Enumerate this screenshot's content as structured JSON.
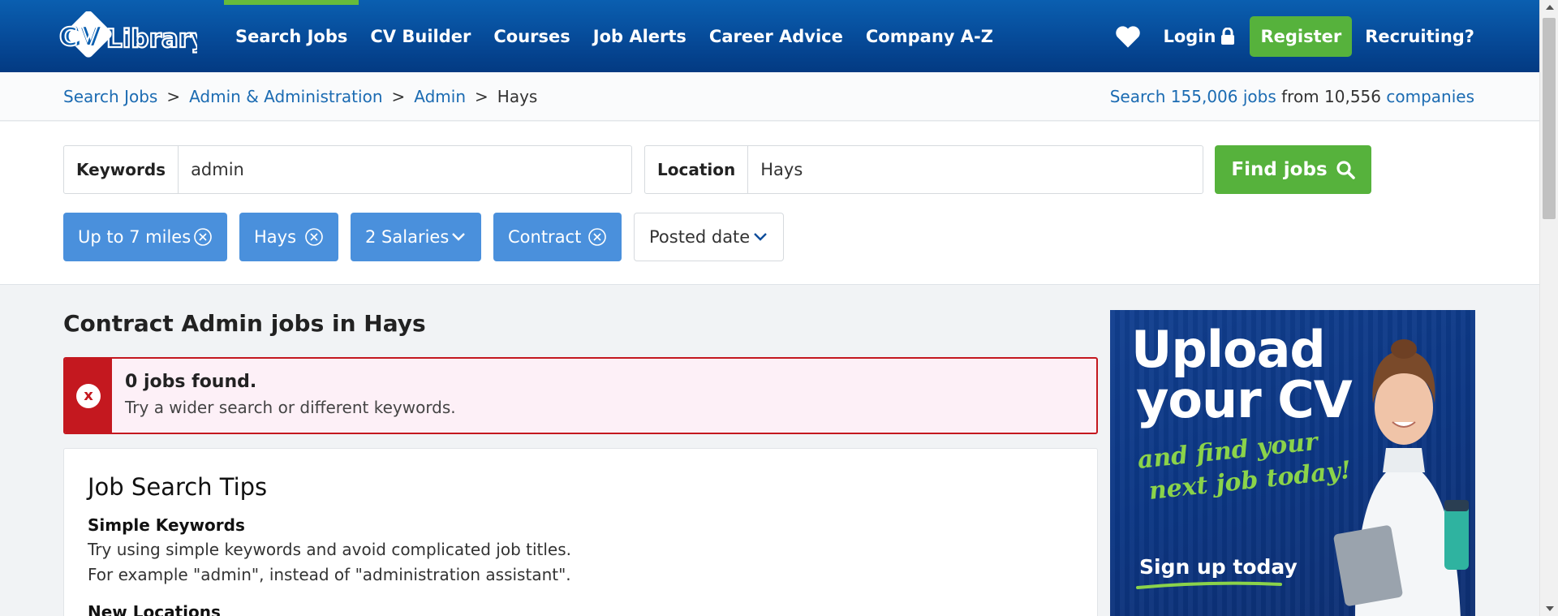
{
  "header": {
    "logo_text": "CV Library",
    "nav": [
      {
        "label": "Search Jobs",
        "active": true
      },
      {
        "label": "CV Builder"
      },
      {
        "label": "Courses"
      },
      {
        "label": "Job Alerts"
      },
      {
        "label": "Career Advice"
      },
      {
        "label": "Company A-Z"
      }
    ],
    "login_label": "Login",
    "register_label": "Register",
    "recruiting_label": "Recruiting?"
  },
  "breadcrumb": {
    "items": [
      "Search Jobs",
      "Admin & Administration",
      "Admin",
      "Hays"
    ],
    "separator": ">"
  },
  "stats": {
    "prefix": "Search",
    "jobs_link": "155,006 jobs",
    "middle": "from 10,556",
    "companies_link": "companies"
  },
  "search": {
    "keywords_label": "Keywords",
    "keywords_value": "admin",
    "location_label": "Location",
    "location_value": "Hays",
    "find_label": "Find jobs"
  },
  "filters": [
    {
      "label": "Up to 7 miles",
      "type": "removable"
    },
    {
      "label": "Hays",
      "type": "removable"
    },
    {
      "label": "2 Salaries",
      "type": "dropdown"
    },
    {
      "label": "Contract",
      "type": "removable"
    },
    {
      "label": "Posted date",
      "type": "dropdown"
    }
  ],
  "results": {
    "title": "Contract Admin jobs in Hays",
    "alert_title": "0 jobs found.",
    "alert_text": "Try a wider search or different keywords.",
    "alert_icon_text": "x"
  },
  "tips": {
    "title": "Job Search Tips",
    "sections": [
      {
        "heading": "Simple Keywords",
        "lines": [
          "Try using simple keywords and avoid complicated job titles.",
          "For example \"admin\", instead of \"administration assistant\"."
        ]
      },
      {
        "heading": "New Locations"
      }
    ]
  },
  "ad": {
    "line1": "Upload",
    "line2": "your CV",
    "line3": "and find your",
    "line4": "next job today!",
    "cta": "Sign up today"
  },
  "colors": {
    "header_blue": "#064a98",
    "accent_green": "#56b23c",
    "chip_blue": "#4a90dc",
    "link_blue": "#1b6bb2",
    "error_red": "#c4181f"
  }
}
